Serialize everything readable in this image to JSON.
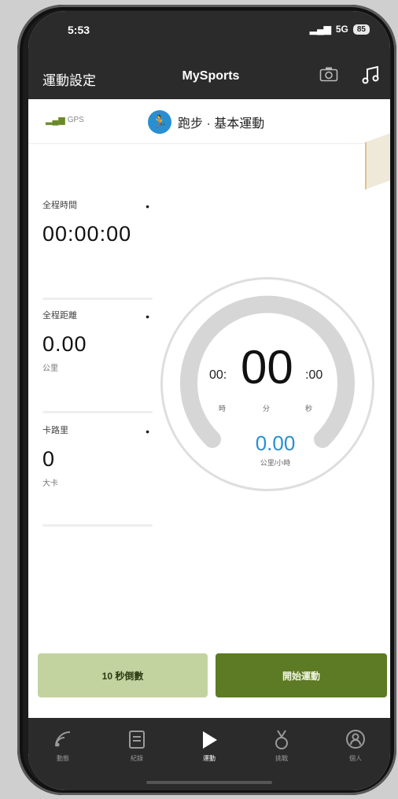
{
  "status": {
    "time": "5:53",
    "signal": "5G",
    "battery": "85"
  },
  "nav": {
    "left": "運動設定",
    "title": "MySports",
    "camera_icon": "camera-icon",
    "music_icon": "music-icon"
  },
  "sport": {
    "gps": "GPS",
    "name": "跑步 · 基本運動"
  },
  "stats": [
    {
      "label": "全程時間",
      "value": "00:00:00",
      "unit": ""
    },
    {
      "label": "全程距離",
      "value": "0.00",
      "unit": "公里"
    },
    {
      "label": "卡路里",
      "value": "0",
      "unit": "大卡"
    }
  ],
  "timer": {
    "hours": "00:",
    "minutes": "00",
    "seconds": ":00",
    "unit_h": "時",
    "unit_m": "分",
    "unit_s": "秒"
  },
  "speed": {
    "value": "0.00",
    "unit": "公里/小時"
  },
  "buttons": {
    "countdown": "10 秒倒數",
    "start": "開始運動"
  },
  "tabs": [
    {
      "label": "動態",
      "icon": "feed-icon",
      "active": false
    },
    {
      "label": "紀錄",
      "icon": "log-icon",
      "active": false
    },
    {
      "label": "運動",
      "icon": "play-icon",
      "active": true
    },
    {
      "label": "挑戰",
      "icon": "medal-icon",
      "active": false
    },
    {
      "label": "個人",
      "icon": "profile-icon",
      "active": false
    }
  ],
  "colors": {
    "accent_blue": "#2a8fd0",
    "start_green": "#5d7a24",
    "countdown_green": "#c3d3a0",
    "dark": "#2b2b2b"
  }
}
